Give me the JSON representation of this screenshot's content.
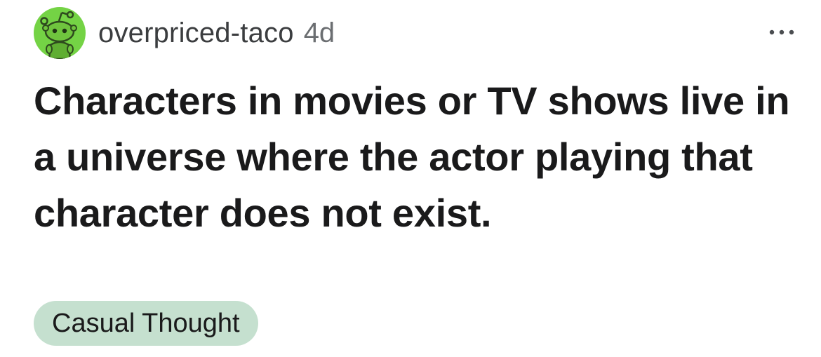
{
  "post": {
    "author": "overpriced-taco",
    "age": "4d",
    "title": "Characters in movies or TV shows live in a universe where the actor playing that character does not exist.",
    "flair": "Casual Thought"
  },
  "icons": {
    "avatar": "snoo-avatar-icon",
    "more": "more-options-icon"
  },
  "colors": {
    "avatar_bg": "#74d345",
    "flair_bg": "#c5e0cf",
    "text": "#1a1a1b",
    "meta_text": "#6b6e71"
  }
}
